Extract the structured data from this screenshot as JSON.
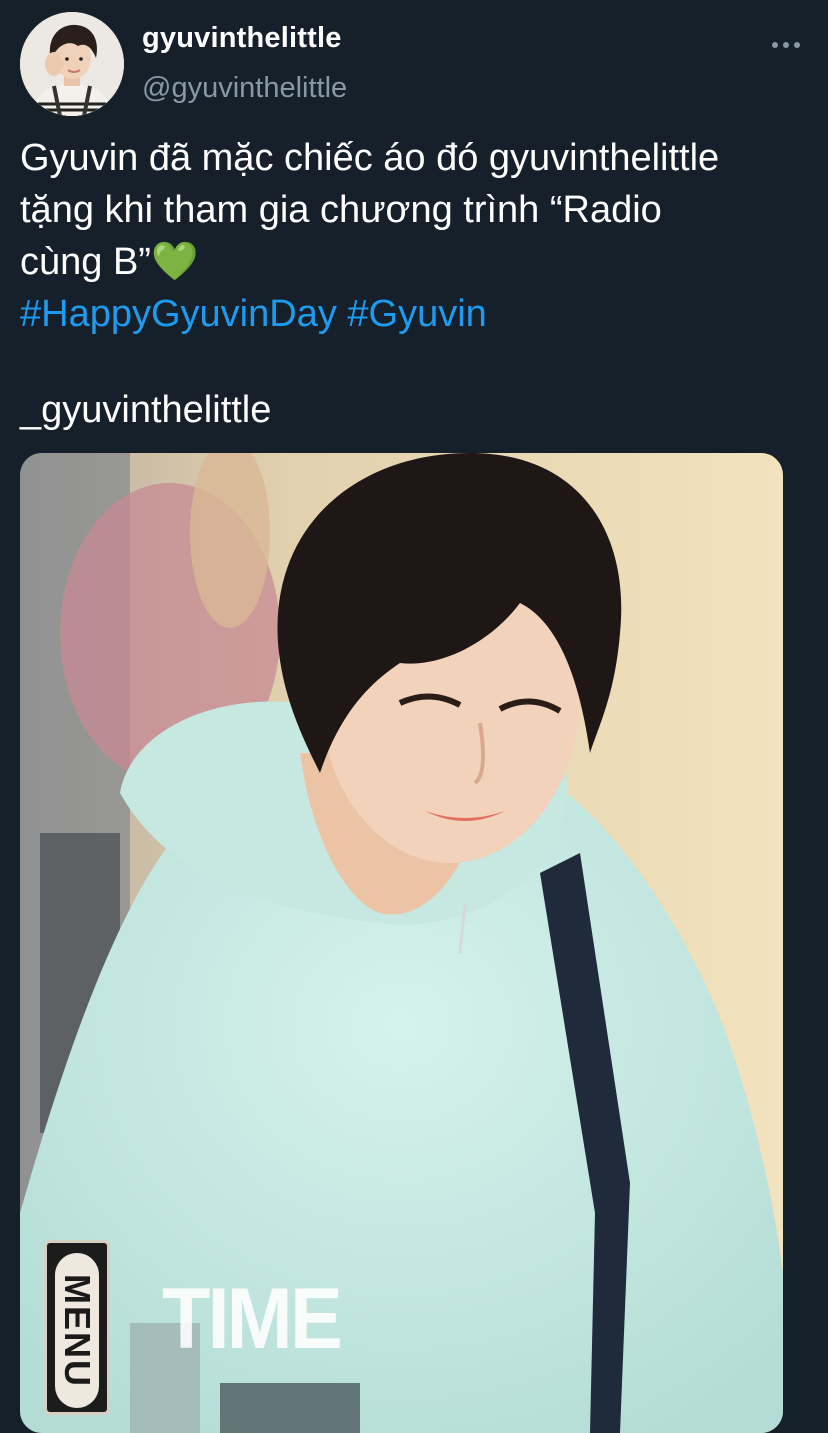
{
  "author": {
    "display_name": "gyuvinthelittle",
    "handle": "@gyuvinthelittle"
  },
  "more_icon": "more-horizontal-icon",
  "tweet": {
    "line1": "Gyuvin đã mặc chiếc áo đó gyuvinthelittle",
    "line2": "tặng khi tham gia chương trình “Radio",
    "line3": "cùng B”💚",
    "hashtag1": "#HappyGyuvinDay",
    "hashtag2": "#Gyuvin",
    "signature": "_gyuvinthelittle"
  },
  "media": {
    "time_text": "TIME",
    "menu_text": "MENU"
  },
  "colors": {
    "background": "#15202b",
    "secondary_text": "#8899a6",
    "link": "#1d9bf0"
  }
}
